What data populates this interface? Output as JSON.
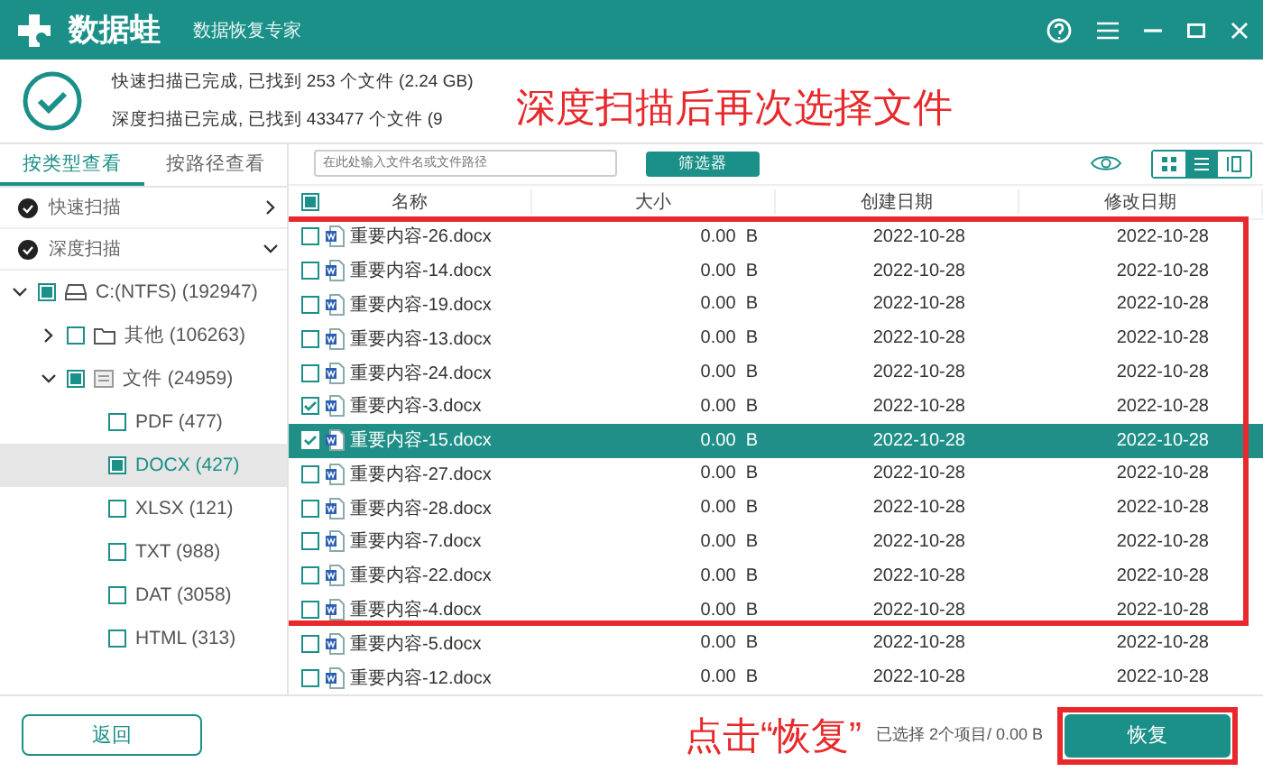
{
  "titlebar": {
    "app_name": "数据蛙",
    "subtitle": "数据恢复专家"
  },
  "header": {
    "status_lines": [
      "快速扫描已完成, 已找到 253 个文件 (2.24 GB)",
      "深度扫描已完成, 已找到 433477 个文件 (9"
    ],
    "annotation": "深度扫描后再次选择文件"
  },
  "sidebar": {
    "tabs": [
      {
        "label": "按类型查看",
        "selected": true
      },
      {
        "label": "按路径查看",
        "selected": false
      }
    ],
    "scans": [
      {
        "label": "快速扫描",
        "expanded": false
      },
      {
        "label": "深度扫描",
        "expanded": true
      }
    ],
    "tree": [
      {
        "label": "C:(NTFS) (192947)",
        "kind": "drive",
        "expanded": true,
        "checked": false,
        "partial": true,
        "selected": false,
        "children": [
          {
            "label": "其他 (106263)",
            "kind": "folder",
            "expanded": false,
            "checked": false,
            "partial": false,
            "selected": false
          },
          {
            "label": "文件 (24959)",
            "kind": "category",
            "expanded": true,
            "checked": false,
            "partial": true,
            "selected": false,
            "children": [
              {
                "label": "PDF (477)",
                "kind": "type",
                "checked": false,
                "partial": false,
                "selected": false
              },
              {
                "label": "DOCX (427)",
                "kind": "type",
                "checked": false,
                "partial": true,
                "selected": true
              },
              {
                "label": "XLSX (121)",
                "kind": "type",
                "checked": false,
                "partial": false,
                "selected": false
              },
              {
                "label": "TXT (988)",
                "kind": "type",
                "checked": false,
                "partial": false,
                "selected": false
              },
              {
                "label": "DAT (3058)",
                "kind": "type",
                "checked": false,
                "partial": false,
                "selected": false
              },
              {
                "label": "HTML (313)",
                "kind": "type",
                "checked": false,
                "partial": false,
                "selected": false
              }
            ]
          }
        ]
      }
    ]
  },
  "toolbar": {
    "search": {
      "placeholder": "在此处输入文件名或文件路径"
    },
    "filter_button": "筛选器",
    "view_modes": [
      {
        "kind": "grid",
        "selected": false
      },
      {
        "kind": "list",
        "selected": true
      },
      {
        "kind": "columns",
        "selected": false
      }
    ]
  },
  "table": {
    "header_checked": false,
    "header_partial": true,
    "columns": [
      "名称",
      "大小",
      "创建日期",
      "修改日期"
    ],
    "red_box_rows": [
      {
        "name": "重要内容-26.docx",
        "size": "0.00",
        "unit": "B",
        "created": "2022-10-28",
        "modified": "2022-10-28",
        "checked": false,
        "selected": false
      },
      {
        "name": "重要内容-14.docx",
        "size": "0.00",
        "unit": "B",
        "created": "2022-10-28",
        "modified": "2022-10-28",
        "checked": false,
        "selected": false
      },
      {
        "name": "重要内容-19.docx",
        "size": "0.00",
        "unit": "B",
        "created": "2022-10-28",
        "modified": "2022-10-28",
        "checked": false,
        "selected": false
      },
      {
        "name": "重要内容-13.docx",
        "size": "0.00",
        "unit": "B",
        "created": "2022-10-28",
        "modified": "2022-10-28",
        "checked": false,
        "selected": false
      },
      {
        "name": "重要内容-24.docx",
        "size": "0.00",
        "unit": "B",
        "created": "2022-10-28",
        "modified": "2022-10-28",
        "checked": false,
        "selected": false
      },
      {
        "name": "重要内容-3.docx",
        "size": "0.00",
        "unit": "B",
        "created": "2022-10-28",
        "modified": "2022-10-28",
        "checked": true,
        "selected": false
      },
      {
        "name": "重要内容-15.docx",
        "size": "0.00",
        "unit": "B",
        "created": "2022-10-28",
        "modified": "2022-10-28",
        "checked": true,
        "selected": true
      },
      {
        "name": "重要内容-27.docx",
        "size": "0.00",
        "unit": "B",
        "created": "2022-10-28",
        "modified": "2022-10-28",
        "checked": false,
        "selected": false
      },
      {
        "name": "重要内容-28.docx",
        "size": "0.00",
        "unit": "B",
        "created": "2022-10-28",
        "modified": "2022-10-28",
        "checked": false,
        "selected": false
      },
      {
        "name": "重要内容-7.docx",
        "size": "0.00",
        "unit": "B",
        "created": "2022-10-28",
        "modified": "2022-10-28",
        "checked": false,
        "selected": false
      },
      {
        "name": "重要内容-22.docx",
        "size": "0.00",
        "unit": "B",
        "created": "2022-10-28",
        "modified": "2022-10-28",
        "checked": false,
        "selected": false
      },
      {
        "name": "重要内容-4.docx",
        "size": "0.00",
        "unit": "B",
        "created": "2022-10-28",
        "modified": "2022-10-28",
        "checked": false,
        "selected": false
      }
    ],
    "rows": [
      {
        "name": "重要内容-5.docx",
        "size": "0.00",
        "unit": "B",
        "created": "2022-10-28",
        "modified": "2022-10-28",
        "checked": false,
        "selected": false
      },
      {
        "name": "重要内容-12.docx",
        "size": "0.00",
        "unit": "B",
        "created": "2022-10-28",
        "modified": "2022-10-28",
        "checked": false,
        "selected": false
      }
    ]
  },
  "footer": {
    "back_button": "返回",
    "annotation": "点击“恢复”",
    "selection_status": "已选择 2个项目/ 0.00 B",
    "recover_button": {
      "label": "恢复",
      "in_red_box": true
    }
  }
}
